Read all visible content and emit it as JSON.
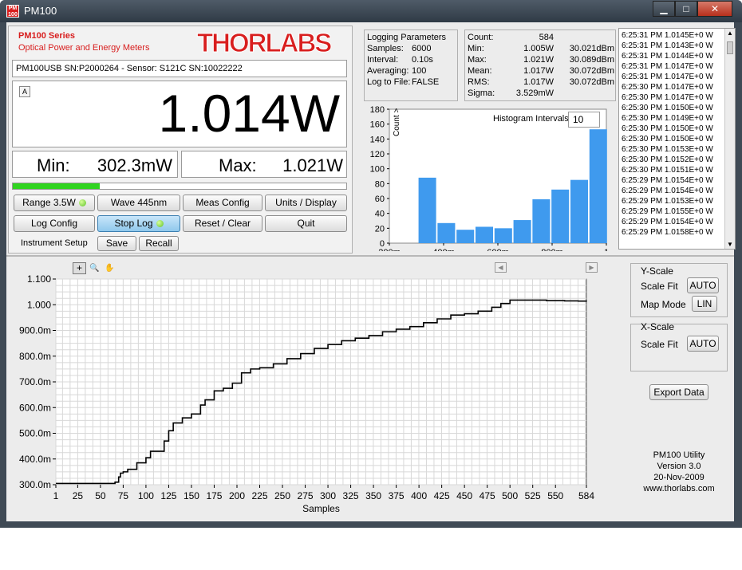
{
  "window": {
    "title": "PM100",
    "icon_text": "PM 100",
    "buttons": [
      "▁",
      "□",
      "✕"
    ]
  },
  "header": {
    "series": "PM100 Series",
    "subtitle": "Optical Power and Energy Meters",
    "logo": "THORLABS"
  },
  "device": {
    "info": "PM100USB SN:P2000264 - Sensor: S121C SN:10022222"
  },
  "reading": {
    "badge": "A",
    "value": "1.014W",
    "min_label": "Min:",
    "min_value": "302.3mW",
    "max_label": "Max:",
    "max_value": "1.021W",
    "level": 0.3
  },
  "buttons": {
    "range": "Range 3.5W",
    "wave": "Wave 445nm",
    "meas_config": "Meas Config",
    "units_display": "Units / Display",
    "log_config": "Log Config",
    "stop_log": "Stop Log",
    "reset_clear": "Reset / Clear",
    "quit": "Quit",
    "instrument_setup": "Instrument Setup",
    "save": "Save",
    "recall": "Recall"
  },
  "logging": {
    "title": "Logging Parameters",
    "rows": [
      {
        "label": "Samples:",
        "value": "6000"
      },
      {
        "label": "Interval:",
        "value": "0.10s"
      },
      {
        "label": "Averaging:",
        "value": "100"
      },
      {
        "label": "Log to File:",
        "value": "FALSE"
      }
    ]
  },
  "stats": {
    "rows": [
      {
        "label": "Count:",
        "w": "584",
        "dbm": ""
      },
      {
        "label": "Min:",
        "w": "1.005W",
        "dbm": "30.021dBm"
      },
      {
        "label": "Max:",
        "w": "1.021W",
        "dbm": "30.089dBm"
      },
      {
        "label": "Mean:",
        "w": "1.017W",
        "dbm": "30.072dBm"
      },
      {
        "label": "RMS:",
        "w": "1.017W",
        "dbm": "30.072dBm"
      },
      {
        "label": "Sigma:",
        "w": "3.529mW",
        "dbm": ""
      }
    ]
  },
  "log_list": [
    "6:25:31 PM 1.0145E+0 W",
    "6:25:31 PM 1.0143E+0 W",
    "6:25:31 PM 1.0144E+0 W",
    "6:25:31 PM 1.0147E+0 W",
    "6:25:31 PM 1.0147E+0 W",
    "6:25:30 PM 1.0147E+0 W",
    "6:25:30 PM 1.0147E+0 W",
    "6:25:30 PM 1.0150E+0 W",
    "6:25:30 PM 1.0149E+0 W",
    "6:25:30 PM 1.0150E+0 W",
    "6:25:30 PM 1.0150E+0 W",
    "6:25:30 PM 1.0153E+0 W",
    "6:25:30 PM 1.0152E+0 W",
    "6:25:30 PM 1.0151E+0 W",
    "6:25:29 PM 1.0154E+0 W",
    "6:25:29 PM 1.0154E+0 W",
    "6:25:29 PM 1.0153E+0 W",
    "6:25:29 PM 1.0155E+0 W",
    "6:25:29 PM 1.0154E+0 W",
    "6:25:29 PM 1.0158E+0 W"
  ],
  "histogram": {
    "intervals_label": "Histogram Intervals",
    "intervals_value": "10",
    "ylabel": "Count >",
    "yticks": [
      "180",
      "160",
      "140",
      "120",
      "100",
      "80",
      "60",
      "40",
      "20",
      "0"
    ],
    "xticks": [
      "200m",
      "400m",
      "600m",
      "800m",
      "1"
    ]
  },
  "chart_data": [
    {
      "type": "bar",
      "ylabel": "Count >",
      "ylim": [
        0,
        180
      ],
      "xlim": [
        0.2,
        1.0
      ],
      "bins_center": [
        0.34,
        0.41,
        0.48,
        0.55,
        0.62,
        0.69,
        0.76,
        0.83,
        0.9,
        0.97
      ],
      "values": [
        88,
        27,
        18,
        22,
        20,
        31,
        59,
        72,
        85,
        153
      ]
    },
    {
      "type": "line",
      "xlabel": "Samples",
      "xlim": [
        1,
        584
      ],
      "ylim": [
        0.3,
        1.1
      ],
      "xticks": [
        "1",
        "25",
        "50",
        "75",
        "100",
        "125",
        "150",
        "175",
        "200",
        "225",
        "250",
        "275",
        "300",
        "325",
        "350",
        "375",
        "400",
        "425",
        "450",
        "475",
        "500",
        "525",
        "550",
        "584"
      ],
      "yticks": [
        "1.100",
        "1.000",
        "900.0m",
        "800.0m",
        "700.0m",
        "600.0m",
        "500.0m",
        "400.0m",
        "300.0m"
      ],
      "x": [
        1,
        50,
        66,
        70,
        72,
        75,
        80,
        90,
        100,
        105,
        110,
        120,
        125,
        130,
        140,
        150,
        160,
        165,
        175,
        185,
        195,
        205,
        215,
        225,
        240,
        255,
        270,
        285,
        300,
        315,
        330,
        345,
        360,
        375,
        390,
        405,
        420,
        435,
        450,
        465,
        480,
        490,
        500,
        520,
        540,
        560,
        575,
        584
      ],
      "y": [
        0.305,
        0.305,
        0.31,
        0.33,
        0.345,
        0.35,
        0.36,
        0.385,
        0.405,
        0.43,
        0.43,
        0.47,
        0.51,
        0.54,
        0.56,
        0.575,
        0.61,
        0.63,
        0.665,
        0.675,
        0.695,
        0.735,
        0.75,
        0.755,
        0.77,
        0.79,
        0.81,
        0.83,
        0.845,
        0.86,
        0.87,
        0.88,
        0.895,
        0.905,
        0.915,
        0.93,
        0.945,
        0.96,
        0.965,
        0.975,
        0.99,
        1.005,
        1.018,
        1.018,
        1.016,
        1.015,
        1.014,
        1.012
      ]
    }
  ],
  "plot": {
    "tools": [
      "+",
      "🔍",
      "✋"
    ]
  },
  "yscale": {
    "title": "Y-Scale",
    "fit_label": "Scale Fit",
    "fit_value": "AUTO",
    "map_label": "Map Mode",
    "map_value": "LIN"
  },
  "xscale": {
    "title": "X-Scale",
    "fit_label": "Scale Fit",
    "fit_value": "AUTO"
  },
  "export": "Export Data",
  "about": {
    "name": "PM100 Utility",
    "version": "Version 3.0",
    "date": "20-Nov-2009",
    "url": "www.thorlabs.com"
  }
}
